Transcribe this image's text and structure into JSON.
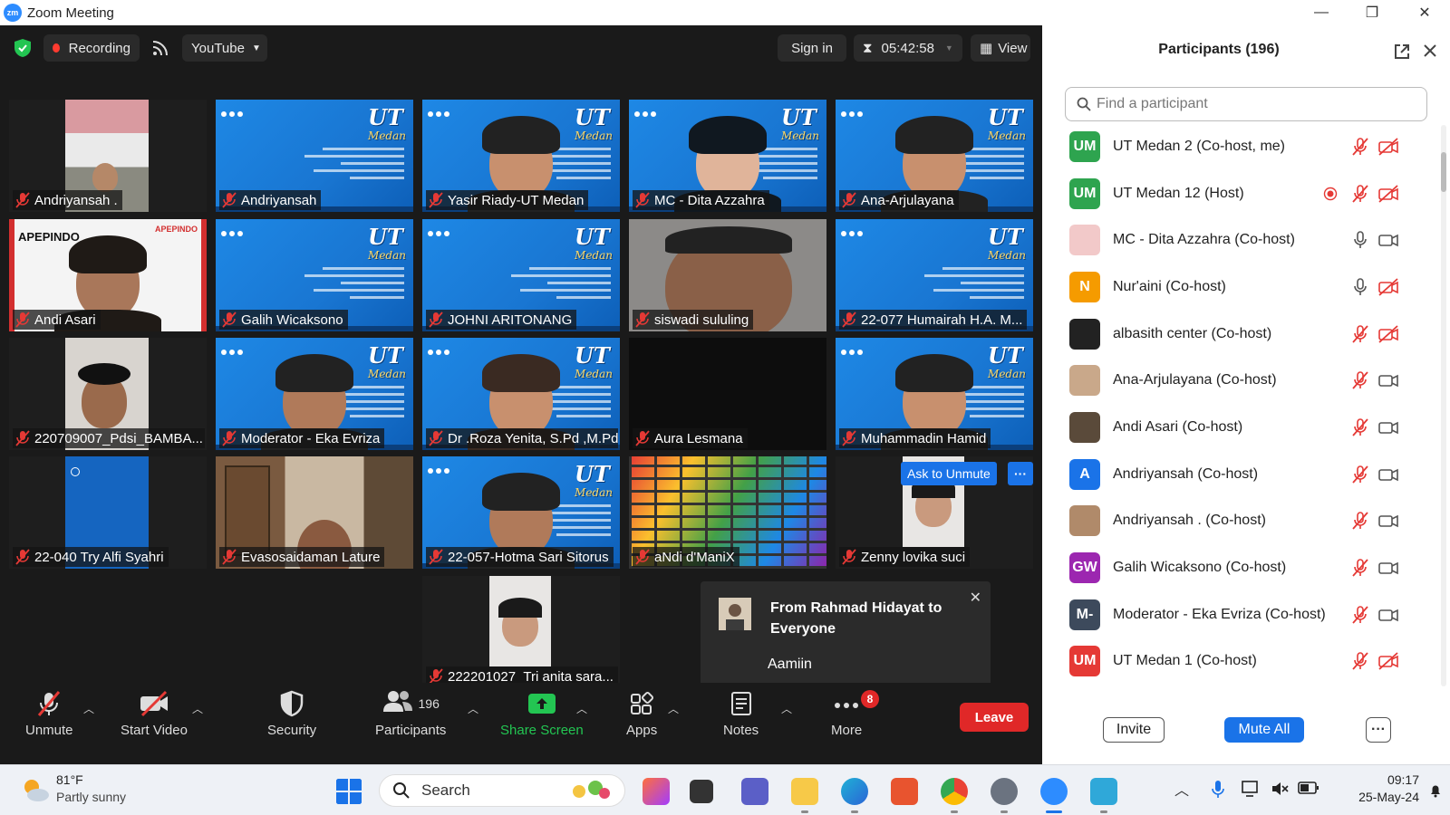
{
  "window": {
    "title": "Zoom Meeting",
    "minimize": "—",
    "restore": "❐",
    "close": "✕"
  },
  "topbar": {
    "recording": "Recording",
    "stream": "YouTube",
    "sign_in": "Sign in",
    "timer": "05:42:58",
    "view": "View"
  },
  "tiles": [
    {
      "name": "Andriyansah ."
    },
    {
      "name": "Andriyansah"
    },
    {
      "name": "Yasir Riady-UT Medan"
    },
    {
      "name": "MC - Dita Azzahra"
    },
    {
      "name": "Ana-Arjulayana"
    },
    {
      "name": "Andi Asari",
      "badge": "APEPINDO"
    },
    {
      "name": "Galih Wicaksono"
    },
    {
      "name": "JOHNI ARITONANG"
    },
    {
      "name": "siswadi sululing"
    },
    {
      "name": "22-077 Humairah H.A. M..."
    },
    {
      "name": "220709007_Pdsi_BAMBA..."
    },
    {
      "name": "Moderator - Eka Evriza"
    },
    {
      "name": "Dr .Roza Yenita, S.Pd ,M.Pd"
    },
    {
      "name": "Aura Lesmana"
    },
    {
      "name": "Muhammadin Hamid"
    },
    {
      "name": "22-040 Try Alfi Syahri"
    },
    {
      "name": "Evasosaidaman Lature"
    },
    {
      "name": "22-057-Hotma Sari Sitorus"
    },
    {
      "name": "aNdi d'ManiX"
    },
    {
      "name": "Zenny lovika suci"
    },
    {
      "name": "222201027_Tri anita sara..."
    }
  ],
  "ask_to_unmute": "Ask to Unmute",
  "more_dots": "···",
  "chat_popup": {
    "from": "From Rahmad Hidayat to Everyone",
    "message": "Aamiin",
    "close": "✕"
  },
  "toolbar": {
    "unmute": "Unmute",
    "start_video": "Start Video",
    "security": "Security",
    "participants": "Participants",
    "participants_count": "196",
    "share_screen": "Share Screen",
    "apps": "Apps",
    "notes": "Notes",
    "more": "More",
    "more_badge": "8",
    "leave": "Leave"
  },
  "panel": {
    "title": "Participants (196)",
    "search_placeholder": "Find a participant",
    "participants": [
      {
        "initials": "UM",
        "name": "UT Medan 2 (Co-host, me)",
        "color": "#2ea44f"
      },
      {
        "initials": "UM",
        "name": "UT Medan 12 (Host)",
        "color": "#2ea44f"
      },
      {
        "initials": "",
        "name": "MC - Dita Azzahra (Co-host)",
        "color": "#f2c9c9"
      },
      {
        "initials": "N",
        "name": "Nur'aini (Co-host)",
        "color": "#f59b00"
      },
      {
        "initials": "",
        "name": "albasith center (Co-host)",
        "color": "#222222"
      },
      {
        "initials": "",
        "name": "Ana-Arjulayana (Co-host)",
        "color": "#c9a88a"
      },
      {
        "initials": "",
        "name": "Andi Asari (Co-host)",
        "color": "#5a4a3a"
      },
      {
        "initials": "A",
        "name": "Andriyansah (Co-host)",
        "color": "#1a73e8"
      },
      {
        "initials": "",
        "name": "Andriyansah . (Co-host)",
        "color": "#b08a6a"
      },
      {
        "initials": "GW",
        "name": "Galih Wicaksono (Co-host)",
        "color": "#9c27b0"
      },
      {
        "initials": "M-",
        "name": "Moderator - Eka Evriza (Co-host)",
        "color": "#3d4a5c"
      },
      {
        "initials": "UM",
        "name": "UT Medan 1 (Co-host)",
        "color": "#e53935"
      }
    ],
    "invite": "Invite",
    "mute_all": "Mute All",
    "more": "···"
  },
  "taskbar": {
    "temperature": "81°F",
    "weather": "Partly sunny",
    "search": "Search",
    "time": "09:17",
    "date": "25-May-24"
  },
  "colors": {
    "accent": "#2d8cff",
    "leave": "#e02828",
    "share": "#23c552",
    "mute_red": "#e53935"
  }
}
